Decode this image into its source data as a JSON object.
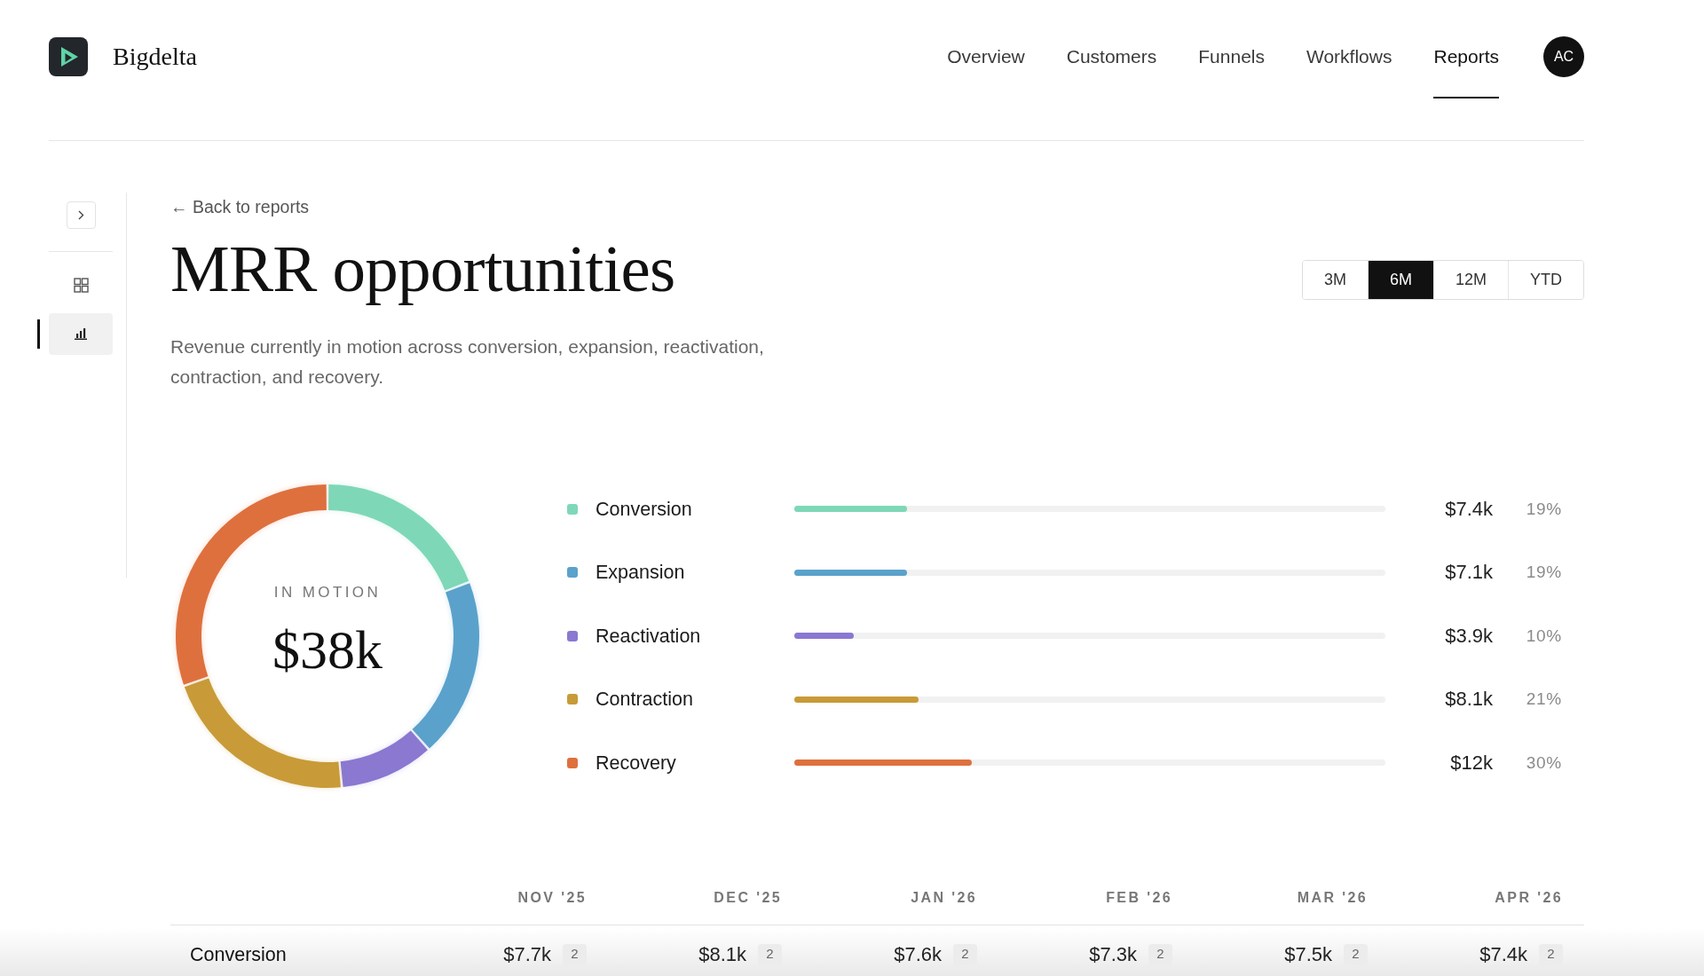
{
  "header": {
    "brand": "Bigdelta",
    "nav": [
      {
        "label": "Overview",
        "selected": false
      },
      {
        "label": "Customers",
        "selected": false
      },
      {
        "label": "Funnels",
        "selected": false
      },
      {
        "label": "Workflows",
        "selected": false
      },
      {
        "label": "Reports",
        "selected": true
      }
    ],
    "avatar": "AC"
  },
  "sidebar": {
    "items": [
      {
        "selected": false
      },
      {
        "selected": true
      }
    ]
  },
  "page": {
    "back_link": "← Back to reports",
    "title": "MRR opportunities",
    "description": "Revenue currently in motion across conversion, expansion, reactivation, contraction, and recovery.",
    "ranges": [
      {
        "label": "3M",
        "selected": false
      },
      {
        "label": "6M",
        "selected": true
      },
      {
        "label": "12M",
        "selected": false
      },
      {
        "label": "YTD",
        "selected": false
      }
    ]
  },
  "breakdown": {
    "center_label": "IN MOTION",
    "center_value": "$38k",
    "chart_data": {
      "type": "donut",
      "values": [
        19,
        19,
        10,
        21,
        30
      ]
    },
    "items": [
      {
        "name": "Conversion",
        "color": "#7ed8b7",
        "level": 0.19,
        "value": "$7.4k",
        "share": "19%"
      },
      {
        "name": "Expansion",
        "color": "#5aa2cb",
        "level": 0.19,
        "value": "$7.1k",
        "share": "19%"
      },
      {
        "name": "Reactivation",
        "color": "#8a78d1",
        "level": 0.1,
        "value": "$3.9k",
        "share": "10%"
      },
      {
        "name": "Contraction",
        "color": "#c89b38",
        "level": 0.21,
        "value": "$8.1k",
        "share": "21%"
      },
      {
        "name": "Recovery",
        "color": "#de703e",
        "level": 0.3,
        "value": "$12k",
        "share": "30%"
      }
    ]
  },
  "table": {
    "columns": [
      "NOV '25",
      "DEC '25",
      "JAN '26",
      "FEB '26",
      "MAR '26",
      "APR '26"
    ],
    "rows": [
      {
        "label": "Conversion",
        "cells": [
          {
            "value": "$7.7k",
            "count": "2"
          },
          {
            "value": "$8.1k",
            "count": "2"
          },
          {
            "value": "$7.6k",
            "count": "2"
          },
          {
            "value": "$7.3k",
            "count": "2"
          },
          {
            "value": "$7.5k",
            "count": "2"
          },
          {
            "value": "$7.4k",
            "count": "2"
          }
        ]
      }
    ]
  }
}
